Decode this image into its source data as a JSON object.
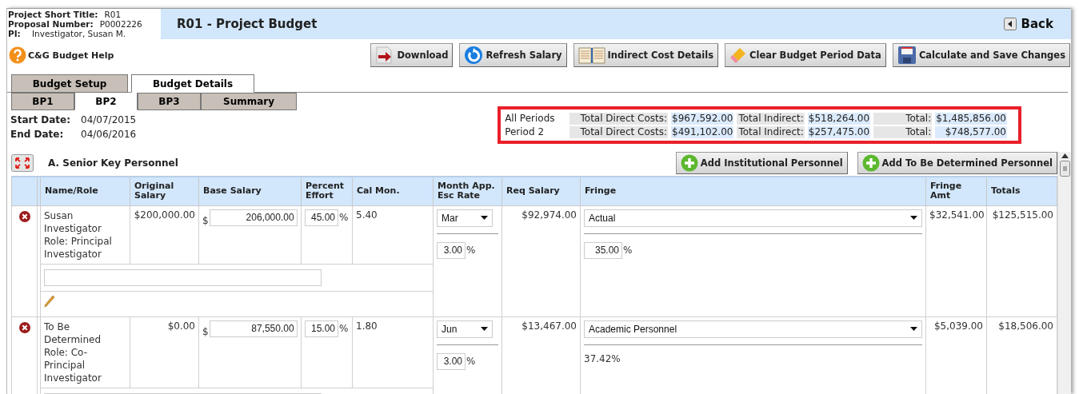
{
  "project_info": [
    {
      "label": "Project Short Title:",
      "value": "R01"
    },
    {
      "label": "Proposal Number:",
      "value": "P0002226"
    },
    {
      "label": "PI:",
      "value": "Investigator, Susan M."
    }
  ],
  "page_title": "R01 - Project Budget",
  "back_button": "Back",
  "help_link": "C&G Budget Help",
  "toolbar_buttons": [
    {
      "label": "Download",
      "kind": "download"
    },
    {
      "label": "Refresh Salary",
      "kind": "refresh"
    },
    {
      "label": "Indirect Cost Details",
      "kind": "book"
    },
    {
      "label": "Clear Budget Period Data",
      "kind": "eraser"
    },
    {
      "label": "Calculate and Save Changes",
      "kind": "save"
    }
  ],
  "tabs": [
    {
      "label": "Budget Setup",
      "selected": false
    },
    {
      "label": "Budget Details",
      "selected": true
    }
  ],
  "period_tabs": [
    {
      "label": "BP1",
      "selected": false
    },
    {
      "label": "BP2",
      "selected": true
    },
    {
      "label": "BP3",
      "selected": false
    },
    {
      "label": "Summary",
      "selected": false
    }
  ],
  "dates": [
    {
      "label": "Start Date:",
      "value": "04/07/2015"
    },
    {
      "label": "End Date:",
      "value": "04/06/2016"
    }
  ],
  "summary": [
    {
      "period": "All Periods",
      "direct_label": "Total Direct Costs:",
      "direct": "$967,592.00",
      "indirect_label": "Total Indirect:",
      "indirect": "$518,264.00",
      "total_label": "Total:",
      "total": "$1,485,856.00"
    },
    {
      "period": "Period 2",
      "direct_label": "Total Direct Costs:",
      "direct": "$491,102.00",
      "indirect_label": "Total Indirect:",
      "indirect": "$257,475.00",
      "total_label": "Total:",
      "total": "$748,577.00"
    }
  ],
  "section": {
    "title": "A. Senior Key Personnel",
    "buttons": [
      "Add Institutional Personnel",
      "Add To Be Determined Personnel"
    ]
  },
  "table": {
    "columns": [
      "Name/Role",
      "Original Salary",
      "Base Salary",
      "Percent Effort",
      "Cal Mon.",
      "Month App. Esc Rate",
      "Req Salary",
      "Fringe",
      "Fringe Amt",
      "Totals"
    ],
    "rows": [
      {
        "name": "Susan Investigator",
        "role": "Role: Principal Investigator",
        "original_salary": "$200,000.00",
        "currency": "$",
        "base_salary": "206,000.00",
        "effort": "45.00",
        "effort_unit": "%",
        "cal_mon": "5.40",
        "month": "Mar",
        "esc_rate": "3.00",
        "esc_unit": "%",
        "req_salary": "$92,974.00",
        "fringe": "Actual",
        "fringe_rate": {
          "kind": "input",
          "value": "35.00",
          "unit": "%"
        },
        "fringe_amt": "$32,541.00",
        "total": "$125,515.00"
      },
      {
        "name": "To Be Determined",
        "role": "Role: Co-Principal Investigator",
        "original_salary": "$0.00",
        "currency": "$",
        "base_salary": "87,550.00",
        "effort": "15.00",
        "effort_unit": "%",
        "cal_mon": "1.80",
        "month": "Jun",
        "esc_rate": "3.00",
        "esc_unit": "%",
        "req_salary": "$13,467.00",
        "fringe": "Academic Personnel",
        "fringe_rate": {
          "kind": "text",
          "value": "37.42%"
        },
        "fringe_amt": "$5,039.00",
        "total": "$18,506.00"
      }
    ]
  }
}
